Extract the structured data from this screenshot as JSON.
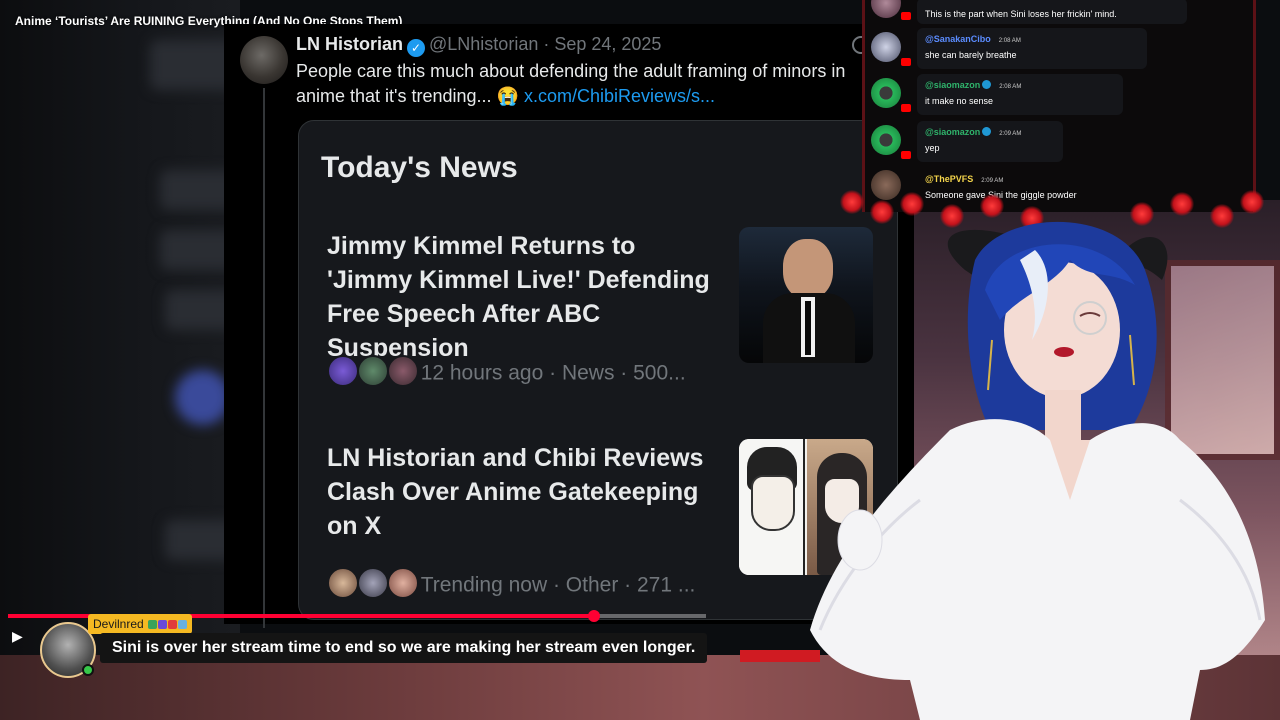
{
  "video": {
    "title": "Anime ‘Tourists’ Are RUINING Everything (And No One Stops Them)",
    "progress_fraction": 0.84
  },
  "tweet": {
    "display_name": "LN Historian",
    "handle": "@LNhistorian",
    "date": "Sep 24, 2025",
    "text": "People care this much about defending the adult framing of minors in anime that it's trending... 😭 ",
    "link_text": "x.com/ChibiReviews/s..."
  },
  "news": {
    "heading": "Today's News",
    "items": [
      {
        "title": "Jimmy Kimmel Returns to 'Jimmy Kimmel Live!' Defending Free Speech After ABC Suspension",
        "meta": "12 hours ago · News · 500..."
      },
      {
        "title": "LN Historian and Chibi Reviews Clash Over Anime Gatekeeping on X",
        "meta": "Trending now · Other · 271 ..."
      }
    ]
  },
  "chat": {
    "messages": [
      {
        "user": "",
        "time": "",
        "text": "This is the part when Sini loses her frickin' mind.",
        "color": "#ffffff"
      },
      {
        "user": "@SanakanCibo",
        "time": "2:08 AM",
        "text": "she can barely breathe",
        "color": "#5b8cff"
      },
      {
        "user": "@siaomazon",
        "time": "2:08 AM",
        "text": "it make no sense",
        "color": "#2fb36b"
      },
      {
        "user": "@siaomazon",
        "time": "2:09 AM",
        "text": "yep",
        "color": "#2fb36b"
      },
      {
        "user": "@ThePVFS",
        "time": "2:09 AM",
        "text": "Someone gave Sini the giggle powder",
        "color": "#f3d44b"
      }
    ]
  },
  "donation": {
    "username": "Devilnred",
    "message": "Sini is over her stream time to end so we are making her stream even longer."
  },
  "icons": {
    "play": "play-icon",
    "verified": "verified-badge-icon",
    "grok": "grok-icon"
  },
  "colors": {
    "accent_red": "#ff0033",
    "twitter_blue": "#1d9bf0",
    "name_tag": "#f5b922"
  }
}
